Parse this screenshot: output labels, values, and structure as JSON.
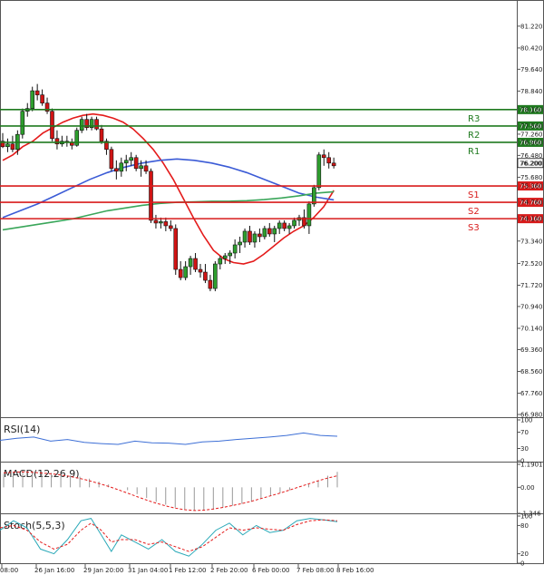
{
  "chart_data": {
    "type": "candlestick",
    "price_axis": {
      "ticks": [
        "81.220",
        "80.420",
        "79.640",
        "78.840",
        "78.160",
        "77.560",
        "77.260",
        "76.960",
        "76.480",
        "76.200",
        "75.680",
        "75.360",
        "74.760",
        "74.160",
        "73.340",
        "72.520",
        "71.720",
        "70.940",
        "70.140",
        "69.360",
        "68.560",
        "67.760",
        "66.980"
      ],
      "ylim": [
        66.98,
        81.98
      ]
    },
    "time_axis": {
      "labels": [
        "08:00",
        "26 Jan 16:00",
        "29 Jan 20:00",
        "31 Jan 04:00",
        "1 Feb 12:00",
        "2 Feb 20:00",
        "6 Feb 00:00",
        "7 Feb 08:00",
        "8 Feb 16:00"
      ]
    },
    "levels": [
      {
        "name": "R3",
        "value": 78.16,
        "label": "78.160",
        "color": "#1f7a1f"
      },
      {
        "name": "R2",
        "value": 77.56,
        "label": "77.560",
        "color": "#1f7a1f"
      },
      {
        "name": "R1",
        "value": 76.96,
        "label": "76.960",
        "color": "#1f7a1f"
      },
      {
        "name": "S1",
        "value": 75.36,
        "label": "75.360",
        "color": "#d81b1b"
      },
      {
        "name": "S2",
        "value": 74.76,
        "label": "74.760",
        "color": "#d81b1b"
      },
      {
        "name": "S3",
        "value": 74.16,
        "label": "74.160",
        "color": "#d81b1b"
      }
    ],
    "current_price": {
      "value": 76.2,
      "label": "76.200"
    },
    "candles": [
      {
        "o": 77.0,
        "h": 77.3,
        "l": 76.75,
        "c": 76.8
      },
      {
        "o": 76.8,
        "h": 77.1,
        "l": 76.6,
        "c": 76.9
      },
      {
        "o": 76.9,
        "h": 77.2,
        "l": 76.6,
        "c": 76.7
      },
      {
        "o": 76.7,
        "h": 77.4,
        "l": 76.5,
        "c": 77.25
      },
      {
        "o": 77.25,
        "h": 78.2,
        "l": 77.1,
        "c": 78.1
      },
      {
        "o": 78.1,
        "h": 78.4,
        "l": 77.9,
        "c": 78.2
      },
      {
        "o": 78.2,
        "h": 79.0,
        "l": 78.1,
        "c": 78.85
      },
      {
        "o": 78.85,
        "h": 79.1,
        "l": 78.5,
        "c": 78.7
      },
      {
        "o": 78.7,
        "h": 78.9,
        "l": 78.3,
        "c": 78.4
      },
      {
        "o": 78.4,
        "h": 78.6,
        "l": 78.0,
        "c": 78.1
      },
      {
        "o": 78.1,
        "h": 78.2,
        "l": 77.0,
        "c": 77.1
      },
      {
        "o": 77.1,
        "h": 77.4,
        "l": 76.7,
        "c": 76.9
      },
      {
        "o": 76.9,
        "h": 77.2,
        "l": 76.8,
        "c": 77.0
      },
      {
        "o": 77.0,
        "h": 77.2,
        "l": 76.8,
        "c": 76.95
      },
      {
        "o": 76.95,
        "h": 77.1,
        "l": 76.7,
        "c": 76.85
      },
      {
        "o": 76.85,
        "h": 77.5,
        "l": 76.8,
        "c": 77.4
      },
      {
        "o": 77.4,
        "h": 77.9,
        "l": 77.3,
        "c": 77.8
      },
      {
        "o": 77.8,
        "h": 78.0,
        "l": 77.4,
        "c": 77.5
      },
      {
        "o": 77.5,
        "h": 77.9,
        "l": 77.4,
        "c": 77.8
      },
      {
        "o": 77.8,
        "h": 77.9,
        "l": 77.4,
        "c": 77.45
      },
      {
        "o": 77.45,
        "h": 77.6,
        "l": 76.9,
        "c": 77.0
      },
      {
        "o": 77.0,
        "h": 77.1,
        "l": 76.5,
        "c": 76.7
      },
      {
        "o": 76.7,
        "h": 76.8,
        "l": 75.9,
        "c": 76.0
      },
      {
        "o": 76.0,
        "h": 76.3,
        "l": 75.6,
        "c": 75.9
      },
      {
        "o": 75.9,
        "h": 76.4,
        "l": 75.7,
        "c": 76.2
      },
      {
        "o": 76.2,
        "h": 76.5,
        "l": 75.9,
        "c": 76.3
      },
      {
        "o": 76.3,
        "h": 76.6,
        "l": 76.1,
        "c": 76.4
      },
      {
        "o": 76.4,
        "h": 76.5,
        "l": 75.9,
        "c": 76.0
      },
      {
        "o": 76.0,
        "h": 76.3,
        "l": 75.7,
        "c": 76.1
      },
      {
        "o": 76.1,
        "h": 76.3,
        "l": 75.8,
        "c": 75.9
      },
      {
        "o": 75.9,
        "h": 76.0,
        "l": 74.0,
        "c": 74.1
      },
      {
        "o": 74.1,
        "h": 74.3,
        "l": 73.8,
        "c": 74.0
      },
      {
        "o": 74.0,
        "h": 74.2,
        "l": 73.8,
        "c": 74.05
      },
      {
        "o": 74.05,
        "h": 74.2,
        "l": 73.7,
        "c": 73.9
      },
      {
        "o": 73.9,
        "h": 74.1,
        "l": 73.7,
        "c": 73.8
      },
      {
        "o": 73.8,
        "h": 73.95,
        "l": 72.1,
        "c": 72.3
      },
      {
        "o": 72.3,
        "h": 72.6,
        "l": 71.9,
        "c": 72.0
      },
      {
        "o": 72.0,
        "h": 72.6,
        "l": 71.9,
        "c": 72.4
      },
      {
        "o": 72.4,
        "h": 72.8,
        "l": 72.1,
        "c": 72.7
      },
      {
        "o": 72.7,
        "h": 72.9,
        "l": 72.2,
        "c": 72.3
      },
      {
        "o": 72.3,
        "h": 72.5,
        "l": 72.0,
        "c": 72.2
      },
      {
        "o": 72.2,
        "h": 72.5,
        "l": 71.8,
        "c": 71.9
      },
      {
        "o": 71.9,
        "h": 72.1,
        "l": 71.5,
        "c": 71.6
      },
      {
        "o": 71.6,
        "h": 72.6,
        "l": 71.5,
        "c": 72.5
      },
      {
        "o": 72.5,
        "h": 72.8,
        "l": 72.3,
        "c": 72.7
      },
      {
        "o": 72.7,
        "h": 72.9,
        "l": 72.5,
        "c": 72.8
      },
      {
        "o": 72.8,
        "h": 73.0,
        "l": 72.5,
        "c": 72.9
      },
      {
        "o": 72.9,
        "h": 73.4,
        "l": 72.7,
        "c": 73.2
      },
      {
        "o": 73.2,
        "h": 73.5,
        "l": 72.9,
        "c": 73.3
      },
      {
        "o": 73.3,
        "h": 73.8,
        "l": 73.1,
        "c": 73.7
      },
      {
        "o": 73.7,
        "h": 73.9,
        "l": 73.2,
        "c": 73.3
      },
      {
        "o": 73.3,
        "h": 73.7,
        "l": 73.1,
        "c": 73.6
      },
      {
        "o": 73.6,
        "h": 73.8,
        "l": 73.3,
        "c": 73.5
      },
      {
        "o": 73.5,
        "h": 73.9,
        "l": 73.4,
        "c": 73.8
      },
      {
        "o": 73.8,
        "h": 74.0,
        "l": 73.5,
        "c": 73.6
      },
      {
        "o": 73.6,
        "h": 73.9,
        "l": 73.3,
        "c": 73.8
      },
      {
        "o": 73.8,
        "h": 74.1,
        "l": 73.6,
        "c": 74.0
      },
      {
        "o": 74.0,
        "h": 74.1,
        "l": 73.7,
        "c": 73.8
      },
      {
        "o": 73.8,
        "h": 74.0,
        "l": 73.6,
        "c": 73.9
      },
      {
        "o": 73.9,
        "h": 74.2,
        "l": 73.8,
        "c": 74.1
      },
      {
        "o": 74.1,
        "h": 74.3,
        "l": 73.9,
        "c": 74.2
      },
      {
        "o": 74.2,
        "h": 74.5,
        "l": 73.8,
        "c": 73.9
      },
      {
        "o": 73.9,
        "h": 74.8,
        "l": 73.6,
        "c": 74.7
      },
      {
        "o": 74.7,
        "h": 75.4,
        "l": 74.6,
        "c": 75.3
      },
      {
        "o": 75.3,
        "h": 76.6,
        "l": 75.2,
        "c": 76.5
      },
      {
        "o": 76.5,
        "h": 76.7,
        "l": 76.1,
        "c": 76.4
      },
      {
        "o": 76.4,
        "h": 76.6,
        "l": 76.0,
        "c": 76.2
      },
      {
        "o": 76.2,
        "h": 76.4,
        "l": 76.0,
        "c": 76.1
      }
    ],
    "ma_red": [
      76.3,
      76.5,
      76.8,
      77.0,
      77.3,
      77.5,
      77.7,
      77.85,
      77.95,
      78.0,
      77.95,
      77.85,
      77.7,
      77.45,
      77.1,
      76.7,
      76.2,
      75.6,
      74.9,
      74.2,
      73.55,
      73.0,
      72.7,
      72.55,
      72.5,
      72.6,
      72.85,
      73.15,
      73.45,
      73.7,
      73.9,
      74.2,
      74.6,
      75.2
    ],
    "ma_blue": [
      74.2,
      74.45,
      74.7,
      75.0,
      75.3,
      75.6,
      75.85,
      76.05,
      76.2,
      76.3,
      76.35,
      76.3,
      76.2,
      76.05,
      75.85,
      75.6,
      75.35,
      75.1,
      74.95,
      74.85
    ],
    "ma_green": [
      73.75,
      73.85,
      73.95,
      74.05,
      74.15,
      74.3,
      74.45,
      74.55,
      74.65,
      74.72,
      74.76,
      74.78,
      74.8,
      74.8,
      74.82,
      74.86,
      74.92,
      75.0,
      75.1,
      75.15
    ],
    "indicators": [
      {
        "name": "RSI(14)",
        "ticks": [
          "100",
          "70",
          "30",
          "0"
        ],
        "range": [
          0,
          100
        ],
        "series": [
          [
            0,
            50
          ],
          [
            0.05,
            55
          ],
          [
            0.1,
            58
          ],
          [
            0.15,
            48
          ],
          [
            0.2,
            52
          ],
          [
            0.25,
            45
          ],
          [
            0.3,
            42
          ],
          [
            0.35,
            40
          ],
          [
            0.4,
            48
          ],
          [
            0.45,
            44
          ],
          [
            0.5,
            43
          ],
          [
            0.55,
            40
          ],
          [
            0.6,
            46
          ],
          [
            0.65,
            48
          ],
          [
            0.7,
            52
          ],
          [
            0.75,
            55
          ],
          [
            0.8,
            58
          ],
          [
            0.85,
            62
          ],
          [
            0.9,
            68
          ],
          [
            0.95,
            62
          ],
          [
            1,
            60
          ]
        ]
      },
      {
        "name": "MACD(12,26,9)",
        "ticks": [
          "1.1901",
          "0.00",
          "-1.346"
        ],
        "range": [
          -1.346,
          1.1901
        ],
        "histogram": [
          0.7,
          0.8,
          0.85,
          0.85,
          0.8,
          0.75,
          0.7,
          0.62,
          0.55,
          0.45,
          0.3,
          0.15,
          0.0,
          -0.15,
          -0.35,
          -0.55,
          -0.75,
          -0.9,
          -1.05,
          -1.15,
          -1.2,
          -1.2,
          -1.15,
          -1.05,
          -0.95,
          -0.85,
          -0.75,
          -0.6,
          -0.45,
          -0.3,
          -0.15,
          0.0,
          0.15,
          0.35,
          0.6,
          0.8
        ],
        "signal": [
          0.75,
          0.78,
          0.8,
          0.78,
          0.74,
          0.7,
          0.64,
          0.56,
          0.46,
          0.34,
          0.2,
          0.05,
          -0.12,
          -0.3,
          -0.48,
          -0.66,
          -0.82,
          -0.96,
          -1.08,
          -1.16,
          -1.2,
          -1.18,
          -1.12,
          -1.04,
          -0.94,
          -0.84,
          -0.72,
          -0.58,
          -0.44,
          -0.3,
          -0.14,
          0.02,
          0.18,
          0.34,
          0.48,
          0.6
        ]
      },
      {
        "name": "Stoch(5,5,3)",
        "ticks": [
          "100",
          "80",
          "20",
          "0"
        ],
        "range": [
          0,
          100
        ],
        "k": [
          [
            0,
            70
          ],
          [
            0.04,
            90
          ],
          [
            0.08,
            75
          ],
          [
            0.12,
            30
          ],
          [
            0.16,
            20
          ],
          [
            0.2,
            50
          ],
          [
            0.24,
            90
          ],
          [
            0.27,
            95
          ],
          [
            0.3,
            60
          ],
          [
            0.33,
            25
          ],
          [
            0.36,
            60
          ],
          [
            0.4,
            45
          ],
          [
            0.44,
            30
          ],
          [
            0.48,
            50
          ],
          [
            0.52,
            25
          ],
          [
            0.56,
            15
          ],
          [
            0.6,
            40
          ],
          [
            0.64,
            70
          ],
          [
            0.68,
            85
          ],
          [
            0.72,
            60
          ],
          [
            0.76,
            80
          ],
          [
            0.8,
            65
          ],
          [
            0.84,
            70
          ],
          [
            0.88,
            90
          ],
          [
            0.92,
            95
          ],
          [
            0.96,
            92
          ],
          [
            1,
            88
          ]
        ],
        "d": [
          [
            0,
            75
          ],
          [
            0.04,
            80
          ],
          [
            0.08,
            70
          ],
          [
            0.12,
            45
          ],
          [
            0.16,
            30
          ],
          [
            0.2,
            40
          ],
          [
            0.24,
            70
          ],
          [
            0.27,
            85
          ],
          [
            0.3,
            70
          ],
          [
            0.33,
            45
          ],
          [
            0.36,
            50
          ],
          [
            0.4,
            50
          ],
          [
            0.44,
            40
          ],
          [
            0.48,
            45
          ],
          [
            0.52,
            35
          ],
          [
            0.56,
            25
          ],
          [
            0.6,
            35
          ],
          [
            0.64,
            55
          ],
          [
            0.68,
            75
          ],
          [
            0.72,
            70
          ],
          [
            0.76,
            75
          ],
          [
            0.8,
            72
          ],
          [
            0.84,
            70
          ],
          [
            0.88,
            82
          ],
          [
            0.92,
            90
          ],
          [
            0.96,
            92
          ],
          [
            1,
            90
          ]
        ]
      }
    ]
  }
}
